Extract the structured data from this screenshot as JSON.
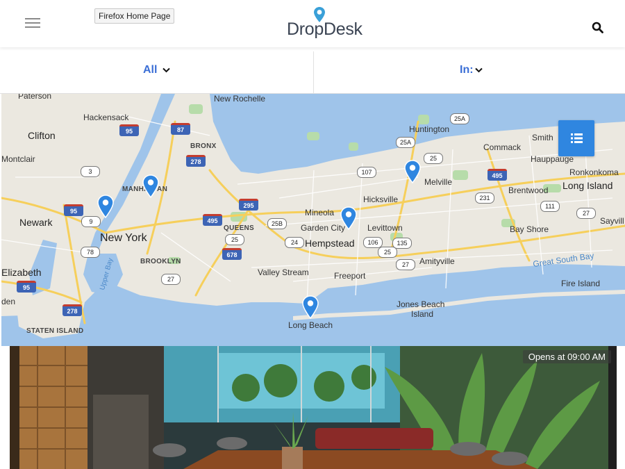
{
  "header": {
    "menu_icon": "hamburger-icon",
    "tooltip": "Firefox Home Page",
    "logo_text": "DropDesk",
    "search_icon": "search-icon",
    "brand_color": "#3b4453",
    "accent_color": "#3b6fd6"
  },
  "filters": {
    "category": "All",
    "location": "In:"
  },
  "map": {
    "labels": {
      "paterson": "Paterson",
      "new_rochelle": "New Rochelle",
      "huntington": "Huntington",
      "hackensack": "Hackensack",
      "clifton": "Clifton",
      "bronx": "BRONX",
      "commack": "Commack",
      "smithtown": "Smith",
      "montclair": "Montclair",
      "hauppauge": "Hauppauge",
      "ronkonkoma": "Ronkonkoma",
      "manhattan": "MANHATTAN",
      "melville": "Melville",
      "brentwood": "Brentwood",
      "long_island": "Long Island",
      "hicksville": "Hicksville",
      "newark": "Newark",
      "mineola": "Mineola",
      "queens": "QUEENS",
      "garden_city": "Garden City",
      "levittown": "Levittown",
      "bay_shore": "Bay Shore",
      "sayville": "Sayvill",
      "new_york": "New York",
      "hempstead": "Hempstead",
      "brooklyn": "BROOKLYN",
      "amityville": "Amityville",
      "elizabeth": "Elizabeth",
      "valley_stream": "Valley Stream",
      "great_south_bay": "Great South Bay",
      "freeport": "Freeport",
      "fire_island": "Fire Island",
      "upper_bay": "Upper Bay",
      "jones_beach": "Jones Beach",
      "island": "Island",
      "long_beach": "Long Beach",
      "staten_island": "STATEN ISLAND",
      "den": "den"
    },
    "interstates": [
      "95",
      "87",
      "278",
      "295",
      "495",
      "678",
      "95",
      "278",
      "95",
      "495"
    ],
    "routes": [
      "25A",
      "25A",
      "25",
      "107",
      "3",
      "9",
      "25B",
      "24",
      "106",
      "135",
      "27",
      "27",
      "231",
      "111",
      "27",
      "78",
      "25",
      "27",
      "24",
      "25"
    ],
    "pin_icon": "map-pin-icon",
    "list_icon": "list-icon"
  },
  "listing": {
    "opens_text": "Opens at 09:00 AM"
  }
}
